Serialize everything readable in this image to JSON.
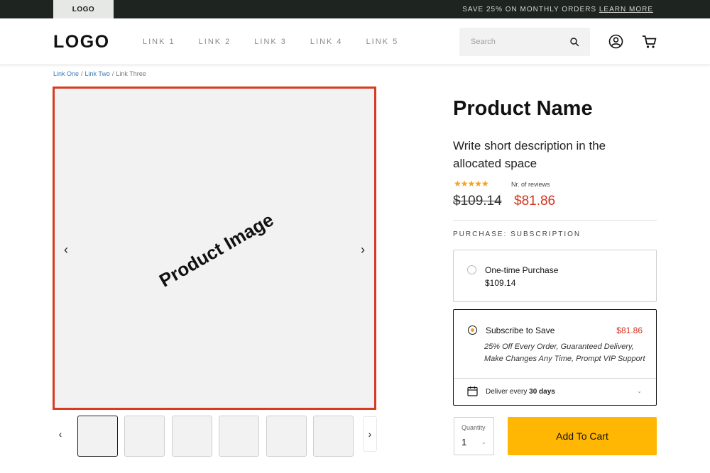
{
  "topbar": {
    "logo": "LOGO",
    "promo_text": "SAVE 25% ON MONTHLY ORDERS",
    "promo_link": "LEARN MORE"
  },
  "header": {
    "brand": "LOGO",
    "nav": [
      "LINK 1",
      "LINK 2",
      "LINK 3",
      "LINK 4",
      "LINK 5"
    ],
    "search_placeholder": "Search",
    "icons": [
      "search-icon",
      "user-icon",
      "cart-icon"
    ]
  },
  "breadcrumb": {
    "items": [
      "Link One",
      "Link Two",
      "Link Three"
    ],
    "separator": "/"
  },
  "gallery": {
    "main_label": "Product Image",
    "prev_arrow": "‹",
    "next_arrow": "›",
    "thumbnail_count": 6,
    "active_thumbnail": 0
  },
  "product": {
    "name": "Product Name",
    "description": "Write short description in the allocated  space",
    "stars": "★★★★★",
    "rating_stars": 5,
    "reviews_label": "Nr. of  reviews",
    "old_price": "$109.14",
    "new_price": "$81.86"
  },
  "purchase": {
    "label": "PURCHASE: SUBSCRIPTION",
    "one_time": {
      "name": "One-time Purchase",
      "price": "$109.14"
    },
    "subscribe": {
      "name": "Subscribe to Save",
      "price": "$81.86",
      "benefits": "25% Off Every Order, Guaranteed Delivery, Make Changes Any Time, Prompt VIP Support",
      "deliver_prefix": "Deliver every",
      "deliver_interval": "30 days"
    }
  },
  "cart": {
    "quantity_label": "Quantity",
    "quantity_value": "1",
    "add_label": "Add To Cart"
  },
  "colors": {
    "accent": "#ffb703",
    "sale": "#d4321e",
    "topbar": "#1e2420",
    "star": "#f2a31b"
  }
}
